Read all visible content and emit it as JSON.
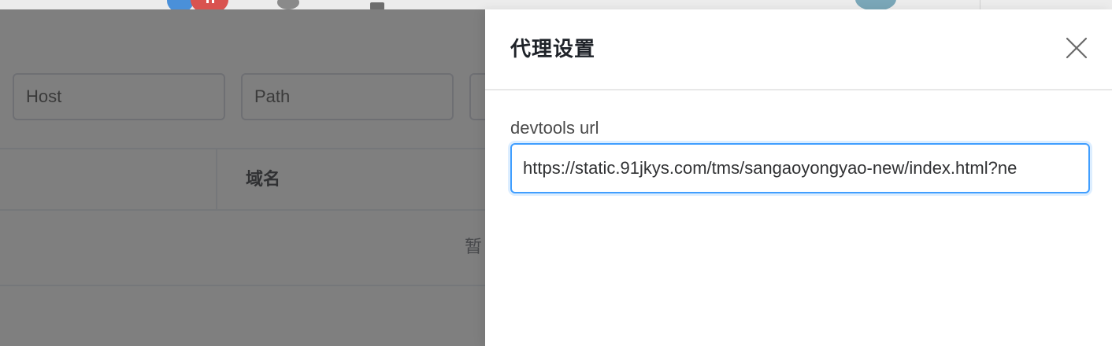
{
  "background": {
    "filters": {
      "host_placeholder": "Host",
      "path_placeholder": "Path"
    },
    "table": {
      "columns": [
        "",
        "域名"
      ],
      "empty_text": "暂"
    }
  },
  "drawer": {
    "title": "代理设置",
    "close_icon": "close-icon",
    "fields": {
      "devtools_url": {
        "label": "devtools url",
        "value": "https://static.91jkys.com/tms/sangaoyongyao-new/index.html?ne"
      }
    }
  },
  "colors": {
    "accent": "#409eff",
    "mask": "rgba(0,0,0,0.5)",
    "title": "#1f2329"
  }
}
